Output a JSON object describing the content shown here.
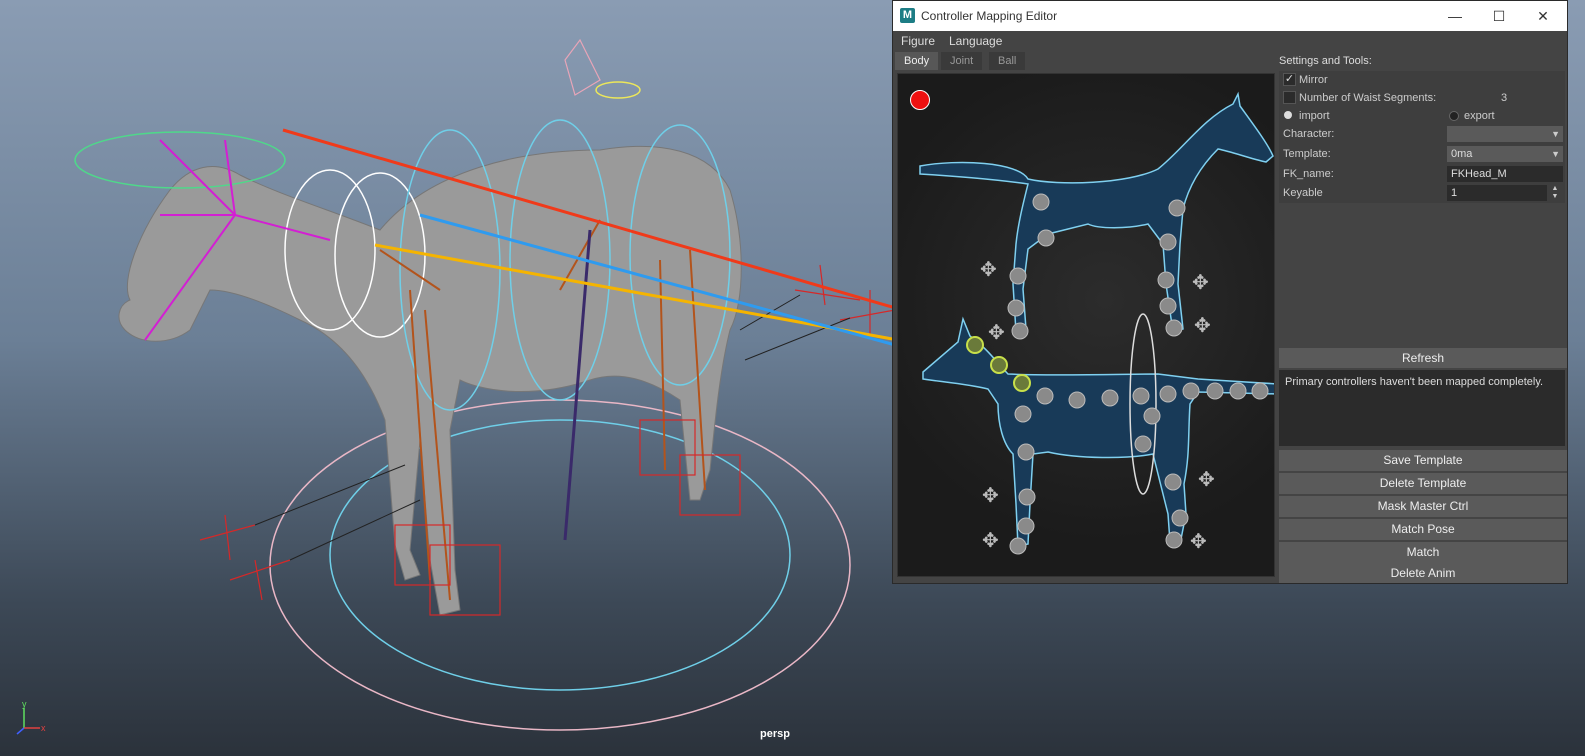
{
  "viewport": {
    "camera_label": "persp",
    "axis_y": "y",
    "axis_x": "x"
  },
  "window": {
    "title": "Controller Mapping Editor",
    "app_icon_letter": "M",
    "controls": {
      "minimize": "—",
      "maximize": "☐",
      "close": "✕"
    }
  },
  "menu": [
    "Figure",
    "Language"
  ],
  "tabs": [
    "Body",
    "Joint",
    "Ball"
  ],
  "settings": {
    "title": "Settings and Tools:",
    "mirror_label": "Mirror",
    "mirror_checked": true,
    "waist_label": "Number of Waist Segments:",
    "waist_value": "3",
    "import_label": "import",
    "export_label": "export",
    "character_label": "Character:",
    "character_value": "",
    "template_label": "Template:",
    "template_value": "0ma",
    "fkname_label": "FK_name:",
    "fkname_value": "FKHead_M",
    "keyable_label": "Keyable",
    "keyable_value": "1"
  },
  "buttons": {
    "refresh": "Refresh",
    "save_template": "Save Template",
    "delete_template": "Delete Template",
    "mask_master": "Mask Master Ctrl",
    "match_pose": "Match Pose",
    "match": "Match",
    "delete_anim": "Delete Anim"
  },
  "message": "Primary controllers haven't been mapped completely.",
  "colors": {
    "arrow_red": "#f03a1a",
    "arrow_orange": "#f5b400",
    "arrow_blue": "#2f9bef",
    "silhouette_fill": "#183a58",
    "silhouette_outline": "#7fd0f0",
    "mapped_marker": "#c8e04a"
  }
}
